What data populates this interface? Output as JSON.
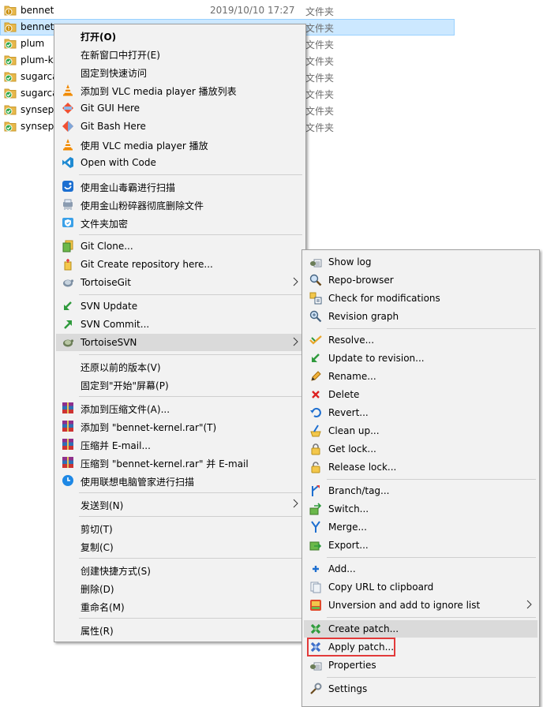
{
  "colors": {
    "selection": "#cce8ff",
    "menu_bg": "#f2f2f2",
    "hover": "#dadada",
    "highlight_box": "#e23a3a"
  },
  "files": [
    {
      "name": "bennet",
      "date": "2019/10/10 17:27",
      "type": "文件夹",
      "status": "warning"
    },
    {
      "name": "bennet-",
      "date": "",
      "type": "文件夹",
      "status": "warning"
    },
    {
      "name": "plum",
      "date": "",
      "type": "文件夹",
      "status": "ok"
    },
    {
      "name": "plum-k",
      "date": "",
      "type": "文件夹",
      "status": "ok"
    },
    {
      "name": "sugarca",
      "date": "",
      "type": "文件夹",
      "status": "ok"
    },
    {
      "name": "sugarca",
      "date": "",
      "type": "文件夹",
      "status": "ok"
    },
    {
      "name": "synsepa",
      "date": "",
      "type": "文件夹",
      "status": "ok"
    },
    {
      "name": "synsepa",
      "date": "",
      "type": "文件夹",
      "status": "ok"
    }
  ],
  "context_menu": {
    "items": [
      {
        "label": "打开(O)",
        "icon": "none"
      },
      {
        "label": "在新窗口中打开(E)",
        "icon": "none"
      },
      {
        "label": "固定到快速访问",
        "icon": "none"
      },
      {
        "label": "添加到 VLC media player 播放列表",
        "icon": "vlc-icon"
      },
      {
        "label": "Git GUI Here",
        "icon": "git-gui-icon"
      },
      {
        "label": "Git Bash Here",
        "icon": "git-bash-icon"
      },
      {
        "label": "使用 VLC media player 播放",
        "icon": "vlc-icon"
      },
      {
        "label": "Open with Code",
        "icon": "vscode-icon"
      },
      {
        "label": "使用金山毒霸进行扫描",
        "icon": "kingsoft-scan-icon"
      },
      {
        "label": "使用金山粉碎器彻底删除文件",
        "icon": "shredder-icon"
      },
      {
        "label": "文件夹加密",
        "icon": "folder-lock-icon"
      },
      {
        "label": "Git Clone...",
        "icon": "git-clone-icon"
      },
      {
        "label": "Git Create repository here...",
        "icon": "git-create-repo-icon"
      },
      {
        "label": "TortoiseGit",
        "icon": "tortoisegit-icon"
      },
      {
        "label": "SVN Update",
        "icon": "svn-update-icon"
      },
      {
        "label": "SVN Commit...",
        "icon": "svn-commit-icon"
      },
      {
        "label": "TortoiseSVN",
        "icon": "tortoisesvn-icon"
      },
      {
        "label": "还原以前的版本(V)",
        "icon": "none"
      },
      {
        "label": "固定到\"开始\"屏幕(P)",
        "icon": "none"
      },
      {
        "label": "添加到压缩文件(A)...",
        "icon": "winrar-icon"
      },
      {
        "label": "添加到 \"bennet-kernel.rar\"(T)",
        "icon": "winrar-icon"
      },
      {
        "label": "压缩并 E-mail...",
        "icon": "winrar-icon"
      },
      {
        "label": "压缩到 \"bennet-kernel.rar\" 并 E-mail",
        "icon": "winrar-icon"
      },
      {
        "label": "使用联想电脑管家进行扫描",
        "icon": "lenovo-scan-icon"
      },
      {
        "label": "发送到(N)",
        "icon": "none"
      },
      {
        "label": "剪切(T)",
        "icon": "none"
      },
      {
        "label": "复制(C)",
        "icon": "none"
      },
      {
        "label": "创建快捷方式(S)",
        "icon": "none"
      },
      {
        "label": "删除(D)",
        "icon": "none"
      },
      {
        "label": "重命名(M)",
        "icon": "none"
      },
      {
        "label": "属性(R)",
        "icon": "none"
      }
    ]
  },
  "svn_submenu": {
    "items": [
      {
        "label": "Show log",
        "icon": "show-log-icon"
      },
      {
        "label": "Repo-browser",
        "icon": "repo-browser-icon"
      },
      {
        "label": "Check for modifications",
        "icon": "check-modifications-icon"
      },
      {
        "label": "Revision graph",
        "icon": "revision-graph-icon"
      },
      {
        "label": "Resolve...",
        "icon": "resolve-icon"
      },
      {
        "label": "Update to revision...",
        "icon": "update-revision-icon"
      },
      {
        "label": "Rename...",
        "icon": "rename-icon"
      },
      {
        "label": "Delete",
        "icon": "delete-icon"
      },
      {
        "label": "Revert...",
        "icon": "revert-icon"
      },
      {
        "label": "Clean up...",
        "icon": "cleanup-icon"
      },
      {
        "label": "Get lock...",
        "icon": "get-lock-icon"
      },
      {
        "label": "Release lock...",
        "icon": "release-lock-icon"
      },
      {
        "label": "Branch/tag...",
        "icon": "branch-tag-icon"
      },
      {
        "label": "Switch...",
        "icon": "switch-icon"
      },
      {
        "label": "Merge...",
        "icon": "merge-icon"
      },
      {
        "label": "Export...",
        "icon": "export-icon"
      },
      {
        "label": "Add...",
        "icon": "add-icon"
      },
      {
        "label": "Copy URL to clipboard",
        "icon": "copy-url-icon"
      },
      {
        "label": "Unversion and add to ignore list",
        "icon": "unversion-icon"
      },
      {
        "label": "Create patch...",
        "icon": "create-patch-icon"
      },
      {
        "label": "Apply patch...",
        "icon": "apply-patch-icon"
      },
      {
        "label": "Properties",
        "icon": "properties-icon"
      },
      {
        "label": "Settings",
        "icon": "settings-icon"
      }
    ]
  }
}
